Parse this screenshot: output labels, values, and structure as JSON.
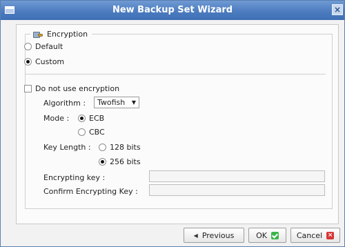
{
  "window": {
    "title": "New Backup Set Wizard",
    "close_glyph": "×"
  },
  "encryption": {
    "legend": "Encryption",
    "options": [
      {
        "label": "Default",
        "selected": false
      },
      {
        "label": "Custom",
        "selected": true
      }
    ],
    "do_not_use": {
      "label": "Do not use encryption",
      "checked": false
    },
    "algorithm": {
      "label": "Algorithm :",
      "value": "Twofish"
    },
    "mode": {
      "label": "Mode :",
      "options": [
        {
          "label": "ECB",
          "selected": true
        },
        {
          "label": "CBC",
          "selected": false
        }
      ]
    },
    "key_length": {
      "label": "Key Length :",
      "options": [
        {
          "label": "128 bits",
          "selected": false
        },
        {
          "label": "256 bits",
          "selected": true
        }
      ]
    },
    "encrypting_key": {
      "label": "Encrypting key :",
      "value": ""
    },
    "confirm_key": {
      "label": "Confirm Encrypting Key :",
      "value": ""
    }
  },
  "buttons": {
    "previous": "Previous",
    "ok": "OK",
    "cancel": "Cancel"
  },
  "icons": {
    "window": "window-icon",
    "encryption": "lock-key-icon",
    "dropdown": "chevron-down-icon",
    "previous": "left-arrow-icon",
    "ok": "check-icon",
    "cancel": "x-icon"
  }
}
